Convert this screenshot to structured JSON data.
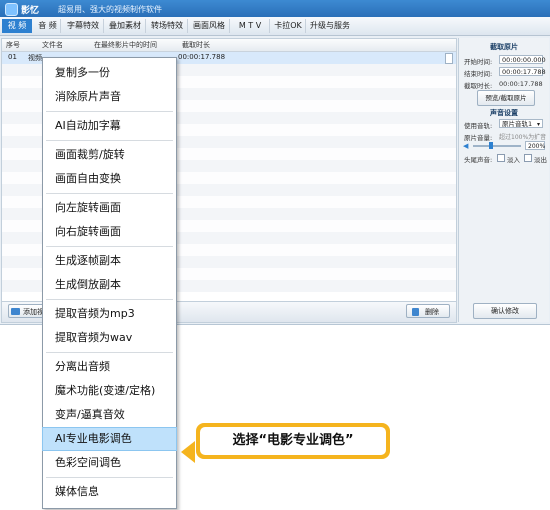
{
  "window": {
    "app_name": "影忆",
    "subtitle": "超易用、强大的视频制作软件"
  },
  "tabs": [
    {
      "label": "视 频",
      "active": true
    },
    {
      "label": "音 频"
    },
    {
      "label": "字幕特效"
    },
    {
      "label": "叠加素材"
    },
    {
      "label": "转场特效"
    },
    {
      "label": "画面风格"
    },
    {
      "label": "M T V"
    },
    {
      "label": "卡拉OK"
    },
    {
      "label": "升级与服务"
    }
  ],
  "list": {
    "columns": [
      "序号",
      "文件名",
      "在最终影片中的时间",
      "截取时长"
    ],
    "rows": [
      {
        "index": "01",
        "filename": "视频",
        "duration": "00:00:17.788"
      }
    ]
  },
  "bottom_bar": {
    "add_label": "添加视",
    "delete_label": "删除"
  },
  "side_panel": {
    "clip_title": "截取原片",
    "start_label": "开始时间:",
    "start_value": "00:00:00.000",
    "end_label": "结束时间:",
    "end_value": "00:00:17.788",
    "length_label": "截取时长:",
    "length_value": "00:00:17.788",
    "preview_button": "预览/截取原片",
    "sound_title": "声音设置",
    "track_label": "使用音轨:",
    "track_value": "原片音轨1",
    "volume_label": "原片音量:",
    "volume_hint": "超过100%为扩音",
    "volume_value": "200%",
    "fade_label": "头尾声音:",
    "fade_in": "淡入",
    "fade_out": "淡出",
    "confirm_button": "确认修改"
  },
  "context_menu": {
    "items": [
      "复制多一份",
      "消除原片声音",
      "AI自动加字幕",
      "画面裁剪/旋转",
      "画面自由变换",
      "向左旋转画面",
      "向右旋转画面",
      "生成逐帧副本",
      "生成倒放副本",
      "提取音频为mp3",
      "提取音频为wav",
      "分离出音频",
      "魔术功能(变速/定格)",
      "变声/逼真音效",
      "AI专业电影调色",
      "色彩空间调色",
      "媒体信息"
    ],
    "highlighted": "AI专业电影调色"
  },
  "callout": {
    "text": "选择“电影专业调色”"
  },
  "colors": {
    "accent": "#2d80d0",
    "callout": "#f5b41e",
    "menu_highlight": "#bfe1fb"
  }
}
